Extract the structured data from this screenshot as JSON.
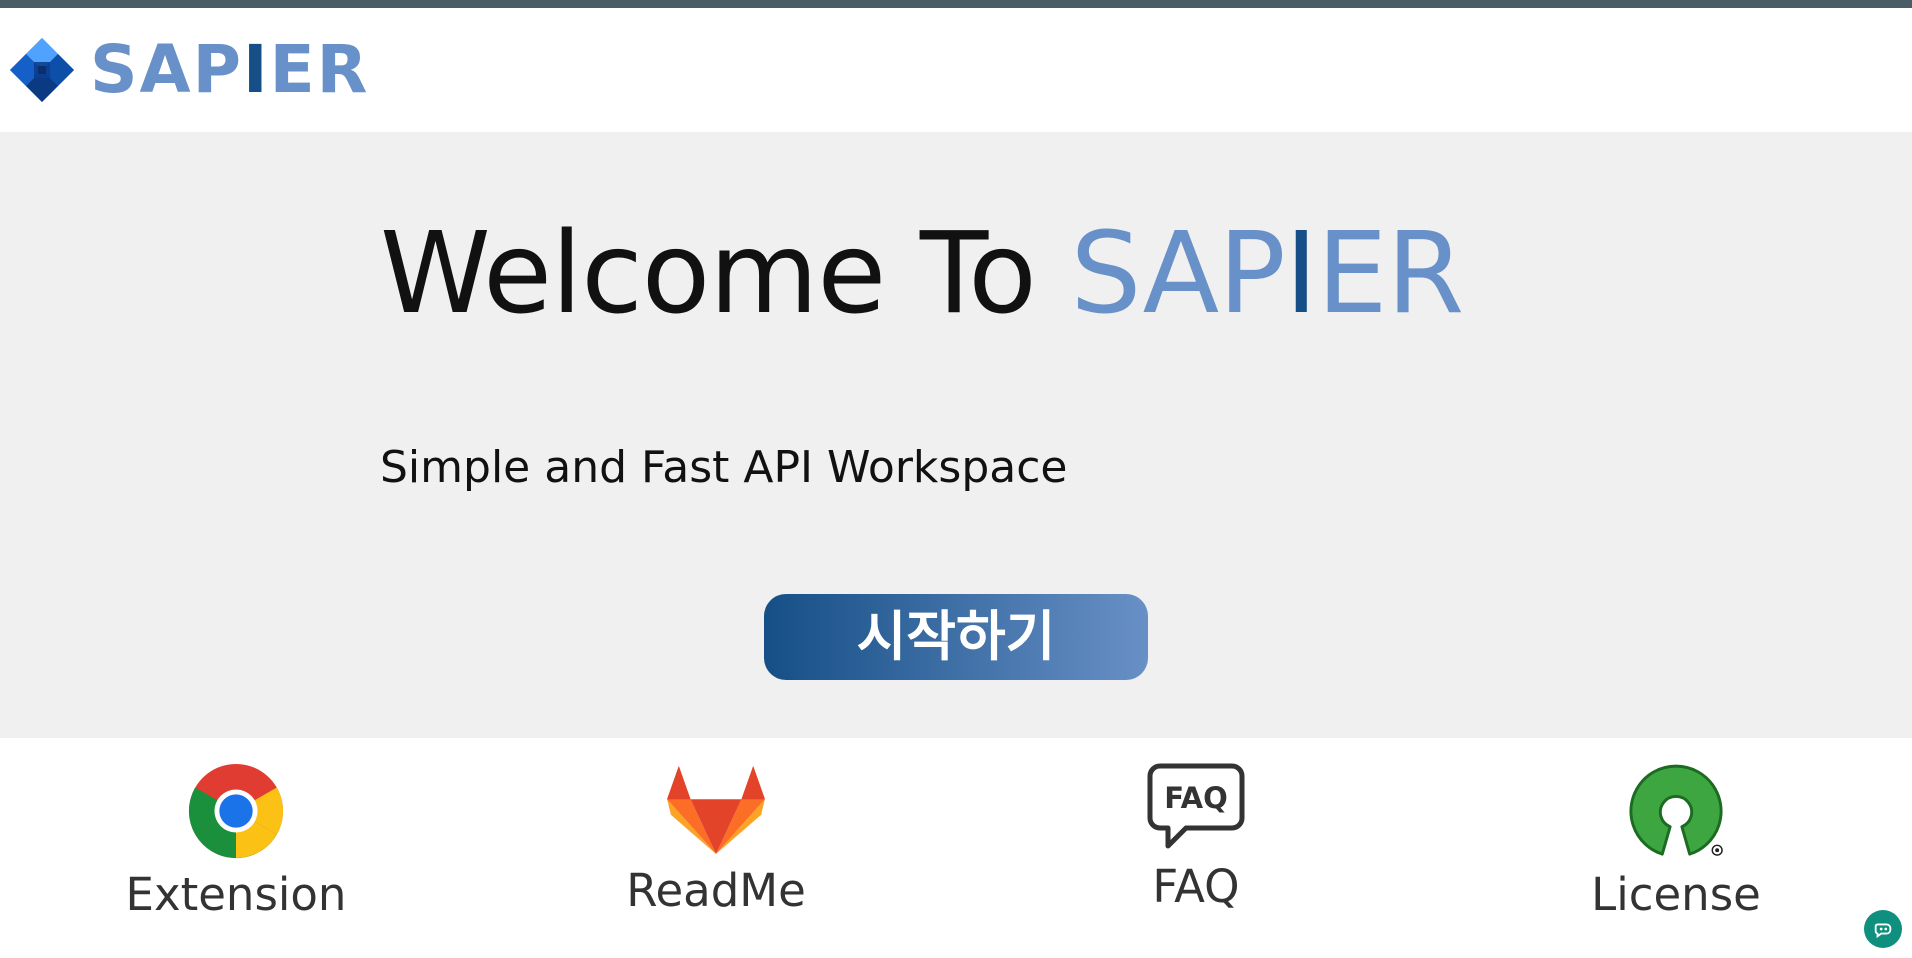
{
  "brand": {
    "logo_light": "SAP",
    "logo_dark": "I",
    "logo_light2": "ER",
    "colors": {
      "light": "#6791c8",
      "dark": "#164f87"
    }
  },
  "hero": {
    "title_prefix": "Welcome To ",
    "title_brand_1": "SAP",
    "title_brand_2": "I",
    "title_brand_3": "ER",
    "subtitle": "Simple and Fast API Workspace",
    "start_label": "시작하기"
  },
  "links": [
    {
      "label": "Extension",
      "icon": "chrome-icon"
    },
    {
      "label": "ReadMe",
      "icon": "gitlab-icon"
    },
    {
      "label": "FAQ",
      "icon": "faq-icon"
    },
    {
      "label": "License",
      "icon": "open-source-icon"
    }
  ],
  "faq_icon_text": "FAQ",
  "assist_icon": "assistant-icon"
}
